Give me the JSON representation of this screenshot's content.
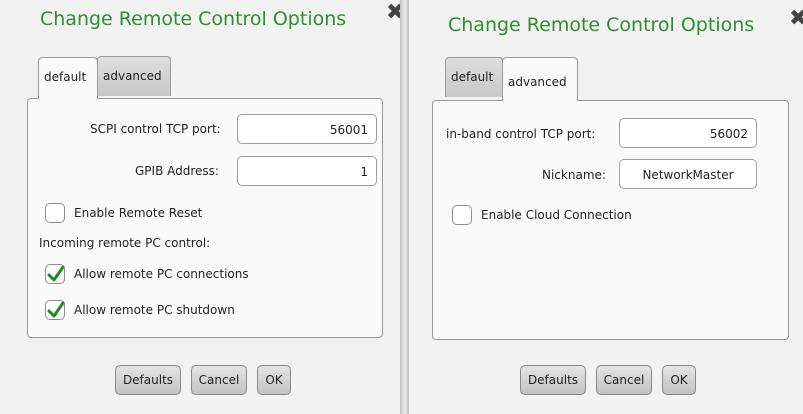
{
  "colors": {
    "title_green": "#2f8f2f",
    "check_green": "#1f8a1f"
  },
  "icons": {
    "close": "close-icon",
    "check": "checkmark-icon"
  },
  "close_glyph": "✖",
  "left_dialog": {
    "title": "Change Remote Control Options",
    "tabs": [
      {
        "label": "default",
        "selected": true
      },
      {
        "label": "advanced",
        "selected": false
      }
    ],
    "scpi_port": {
      "label": "SCPI control TCP port:",
      "value": "56001"
    },
    "gpib": {
      "label": "GPIB Address:",
      "value": "1"
    },
    "enable_remote_reset": {
      "label": "Enable Remote Reset",
      "checked": false
    },
    "incoming_heading": "Incoming remote PC control:",
    "allow_connections": {
      "label": "Allow remote PC connections",
      "checked": true
    },
    "allow_shutdown": {
      "label": "Allow remote PC shutdown",
      "checked": true
    },
    "buttons": {
      "defaults": "Defaults",
      "cancel": "Cancel",
      "ok": "OK"
    }
  },
  "right_dialog": {
    "title": "Change Remote Control Options",
    "tabs": [
      {
        "label": "default",
        "selected": false
      },
      {
        "label": "advanced",
        "selected": true
      }
    ],
    "inband_port": {
      "label": "in-band control TCP port:",
      "value": "56002"
    },
    "nickname": {
      "label": "Nickname:",
      "value": "NetworkMaster"
    },
    "enable_cloud": {
      "label": "Enable Cloud Connection",
      "checked": false
    },
    "buttons": {
      "defaults": "Defaults",
      "cancel": "Cancel",
      "ok": "OK"
    }
  }
}
